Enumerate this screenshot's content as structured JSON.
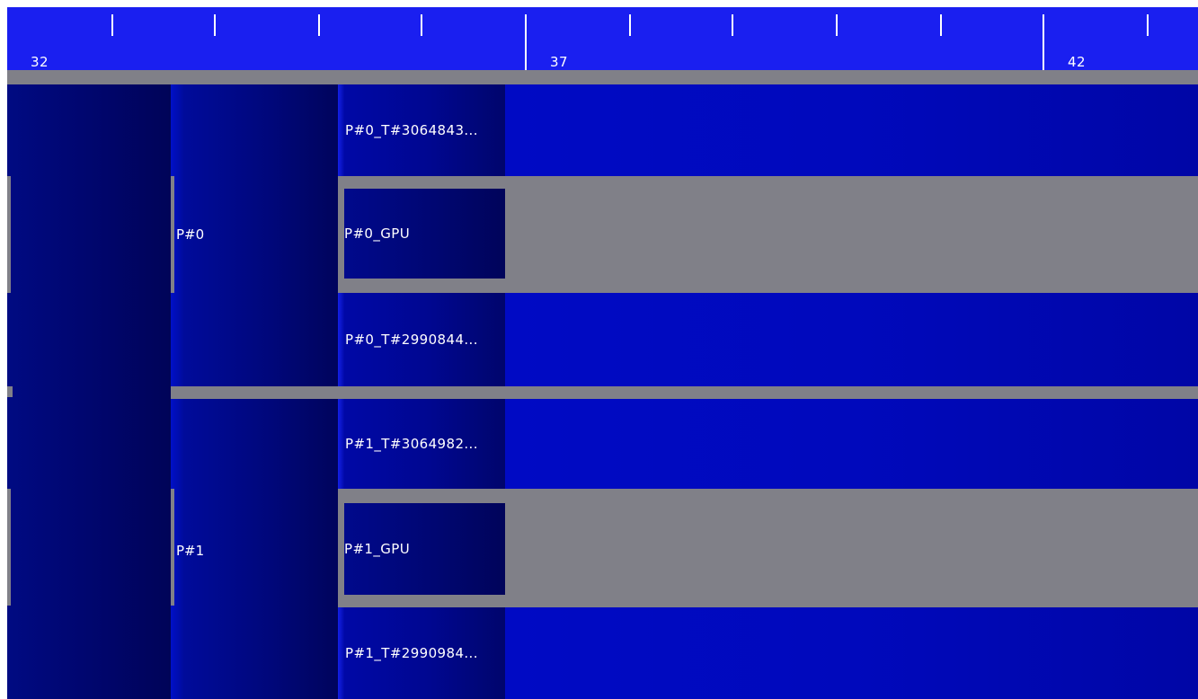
{
  "ruler": {
    "tick_labels": [
      "32",
      "37",
      "42"
    ]
  },
  "processes": [
    {
      "label": "P#0",
      "threads": [
        "P#0_T#3064843...",
        "P#0_T#2990844..."
      ],
      "gpu_label": "P#0_GPU"
    },
    {
      "label": "P#1",
      "threads": [
        "P#1_T#3064982...",
        "P#1_T#2990984..."
      ],
      "gpu_label": "P#1_GPU"
    }
  ],
  "colors": {
    "ruler_bg": "#1a1ff0",
    "separator": "#808088",
    "track_blue": "#0009bc",
    "dark_navy": "#00056a"
  }
}
